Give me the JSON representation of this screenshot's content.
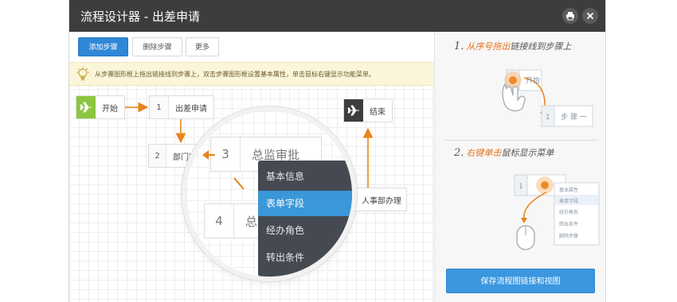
{
  "window": {
    "title": "流程设计器 - 出差申请",
    "print_icon": "print-icon",
    "close_icon": "close-icon"
  },
  "toolbar": {
    "add_step": "添加步骤",
    "delete_step": "删除步骤",
    "more": "更多"
  },
  "hint": {
    "icon": "lightbulb-icon",
    "text": "从步骤图形框上拖出链接线到步骤上，双击步骤图形框设置基本属性，单击鼠标右键显示功能菜单。"
  },
  "flow": {
    "start": {
      "label": "开始",
      "icon": "plane-icon",
      "color": "#8cc63f"
    },
    "end": {
      "label": "结束",
      "icon": "plane-icon",
      "color": "#3d3d3d"
    },
    "nodes": [
      {
        "num": "1",
        "label": "出差申请"
      },
      {
        "num": "2",
        "label": "部门审"
      },
      {
        "num": "",
        "label": "人事部办理"
      }
    ],
    "arrow_color": "#e8841a"
  },
  "magnifier": {
    "nodes": [
      {
        "num": "3",
        "label": "总监审批"
      },
      {
        "num": "4",
        "label": "总"
      }
    ],
    "menu": [
      {
        "label": "基本信息",
        "active": false
      },
      {
        "label": "表单字段",
        "active": true
      },
      {
        "label": "经办角色",
        "active": false
      },
      {
        "label": "转出条件",
        "active": false
      }
    ]
  },
  "tips": {
    "step1": {
      "num": "1.",
      "highlight": "从序号拖出",
      "rest": "链接线到步骤上"
    },
    "step1_illus": {
      "start_label": "开始",
      "num": "1",
      "step_label": "步 骤 一"
    },
    "step2": {
      "num": "2.",
      "highlight": "右键单击",
      "rest": "鼠标显示菜单"
    },
    "step2_illus": {
      "num": "1",
      "menu": [
        "基本属性",
        "表单字段",
        "经办角色",
        "转出条件",
        "删除步骤"
      ]
    }
  },
  "save_button": "保存流程图链接和视图"
}
